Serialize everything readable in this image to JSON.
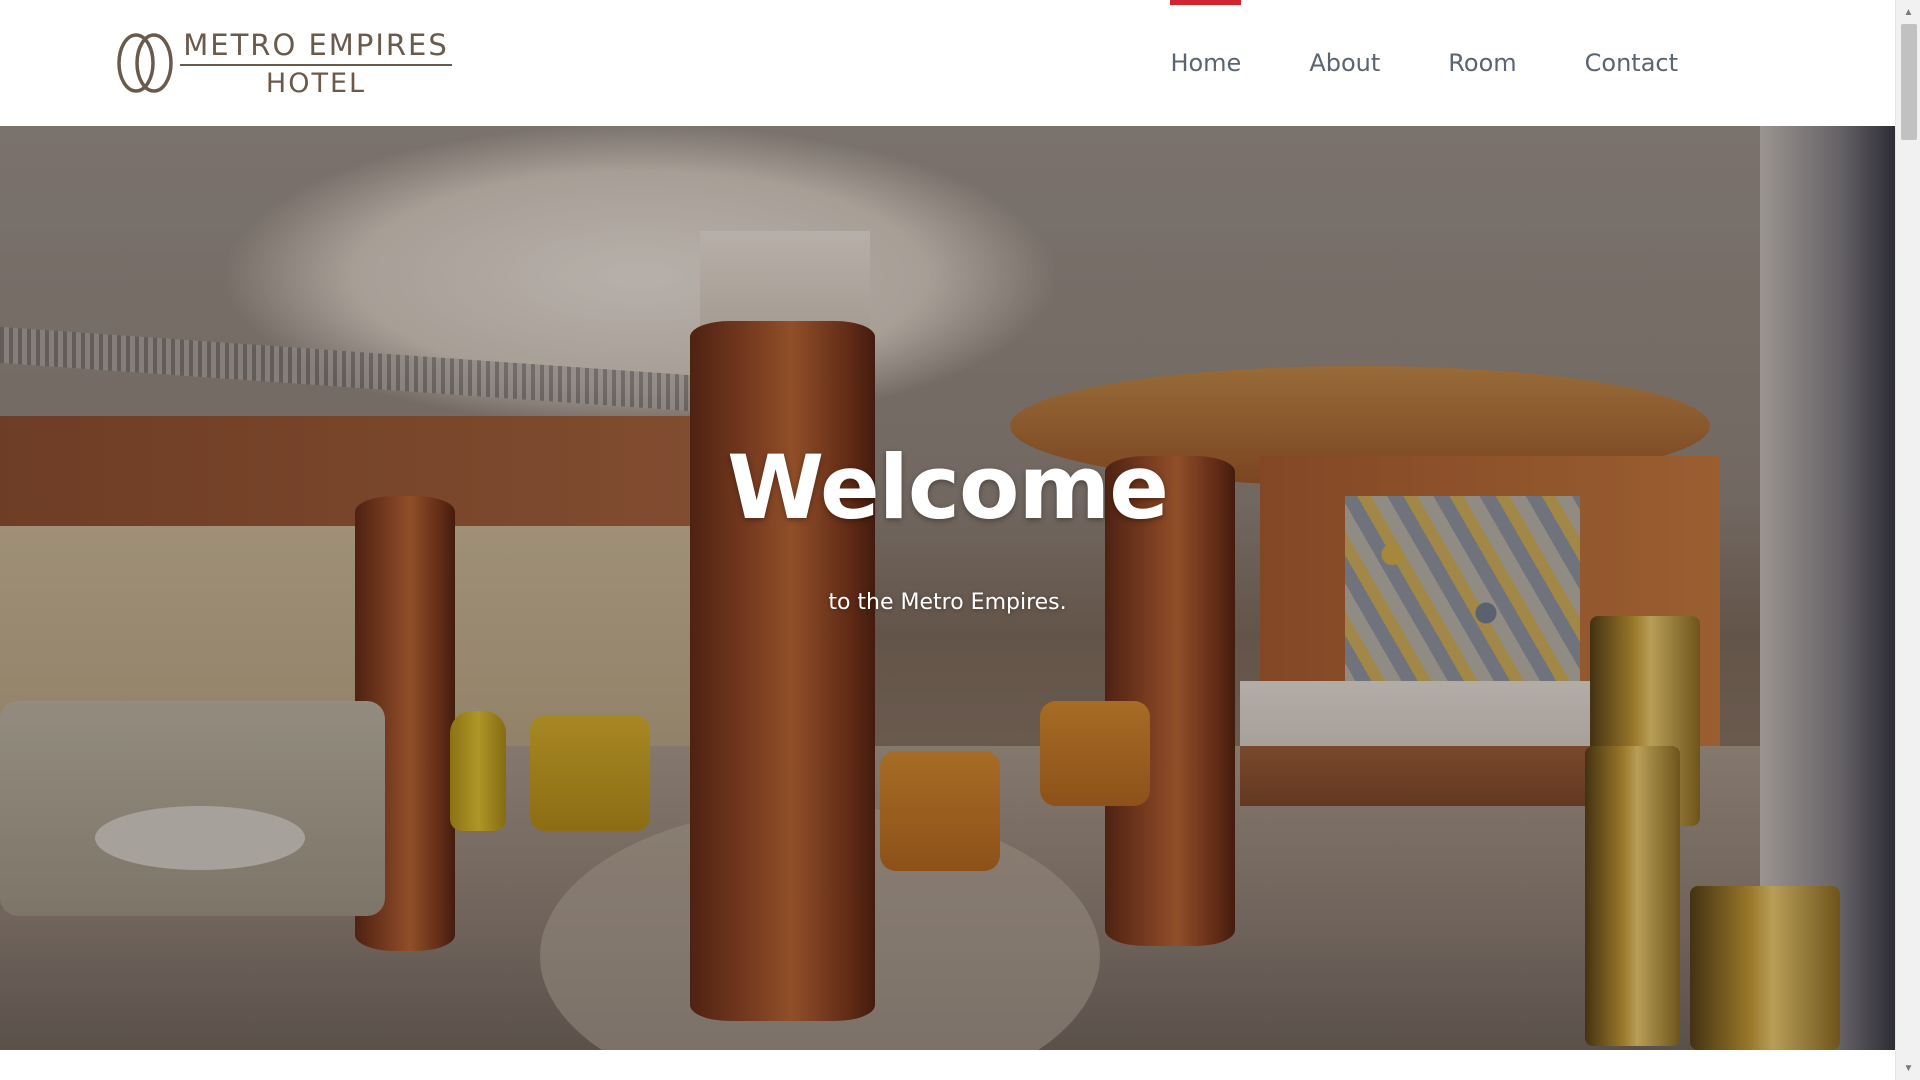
{
  "brand": {
    "line1": "METRO EMPIRES",
    "line2": "HOTEL",
    "logo_icon": "interlocking-rings-icon",
    "color": "#6a5a4b"
  },
  "nav": {
    "items": [
      {
        "label": "Home",
        "active": true
      },
      {
        "label": "About",
        "active": false
      },
      {
        "label": "Room",
        "active": false
      },
      {
        "label": "Contact",
        "active": false
      }
    ],
    "active_indicator_color": "#d0252f",
    "text_color": "#5a6472"
  },
  "hero": {
    "title": "Welcome",
    "subtitle": "to the Metro Empires.",
    "image": "hotel-lobby-photo"
  },
  "scrollbar": {
    "up_icon": "scroll-up-arrow-icon",
    "down_icon": "scroll-down-arrow-icon"
  }
}
